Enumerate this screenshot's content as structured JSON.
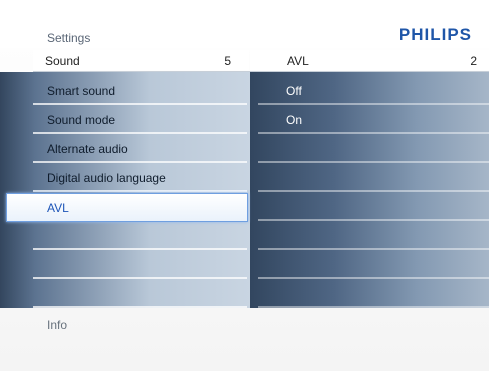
{
  "header": {
    "title": "Settings",
    "brand": "PHILIPS"
  },
  "columns": {
    "left": {
      "label": "Sound",
      "level": "5"
    },
    "right": {
      "label": "AVL",
      "level": "2"
    }
  },
  "menu": {
    "items": [
      {
        "label": "Smart sound"
      },
      {
        "label": "Sound mode"
      },
      {
        "label": "Alternate audio"
      },
      {
        "label": "Digital audio language"
      },
      {
        "label": "AVL"
      }
    ],
    "selected_index": 4
  },
  "options": {
    "items": [
      {
        "label": "Off"
      },
      {
        "label": "On"
      }
    ]
  },
  "footer": {
    "info": "Info"
  },
  "colors": {
    "brand": "#1f56a8",
    "highlight_text": "#1d55b8",
    "highlight_border": "#6f9fe0"
  }
}
